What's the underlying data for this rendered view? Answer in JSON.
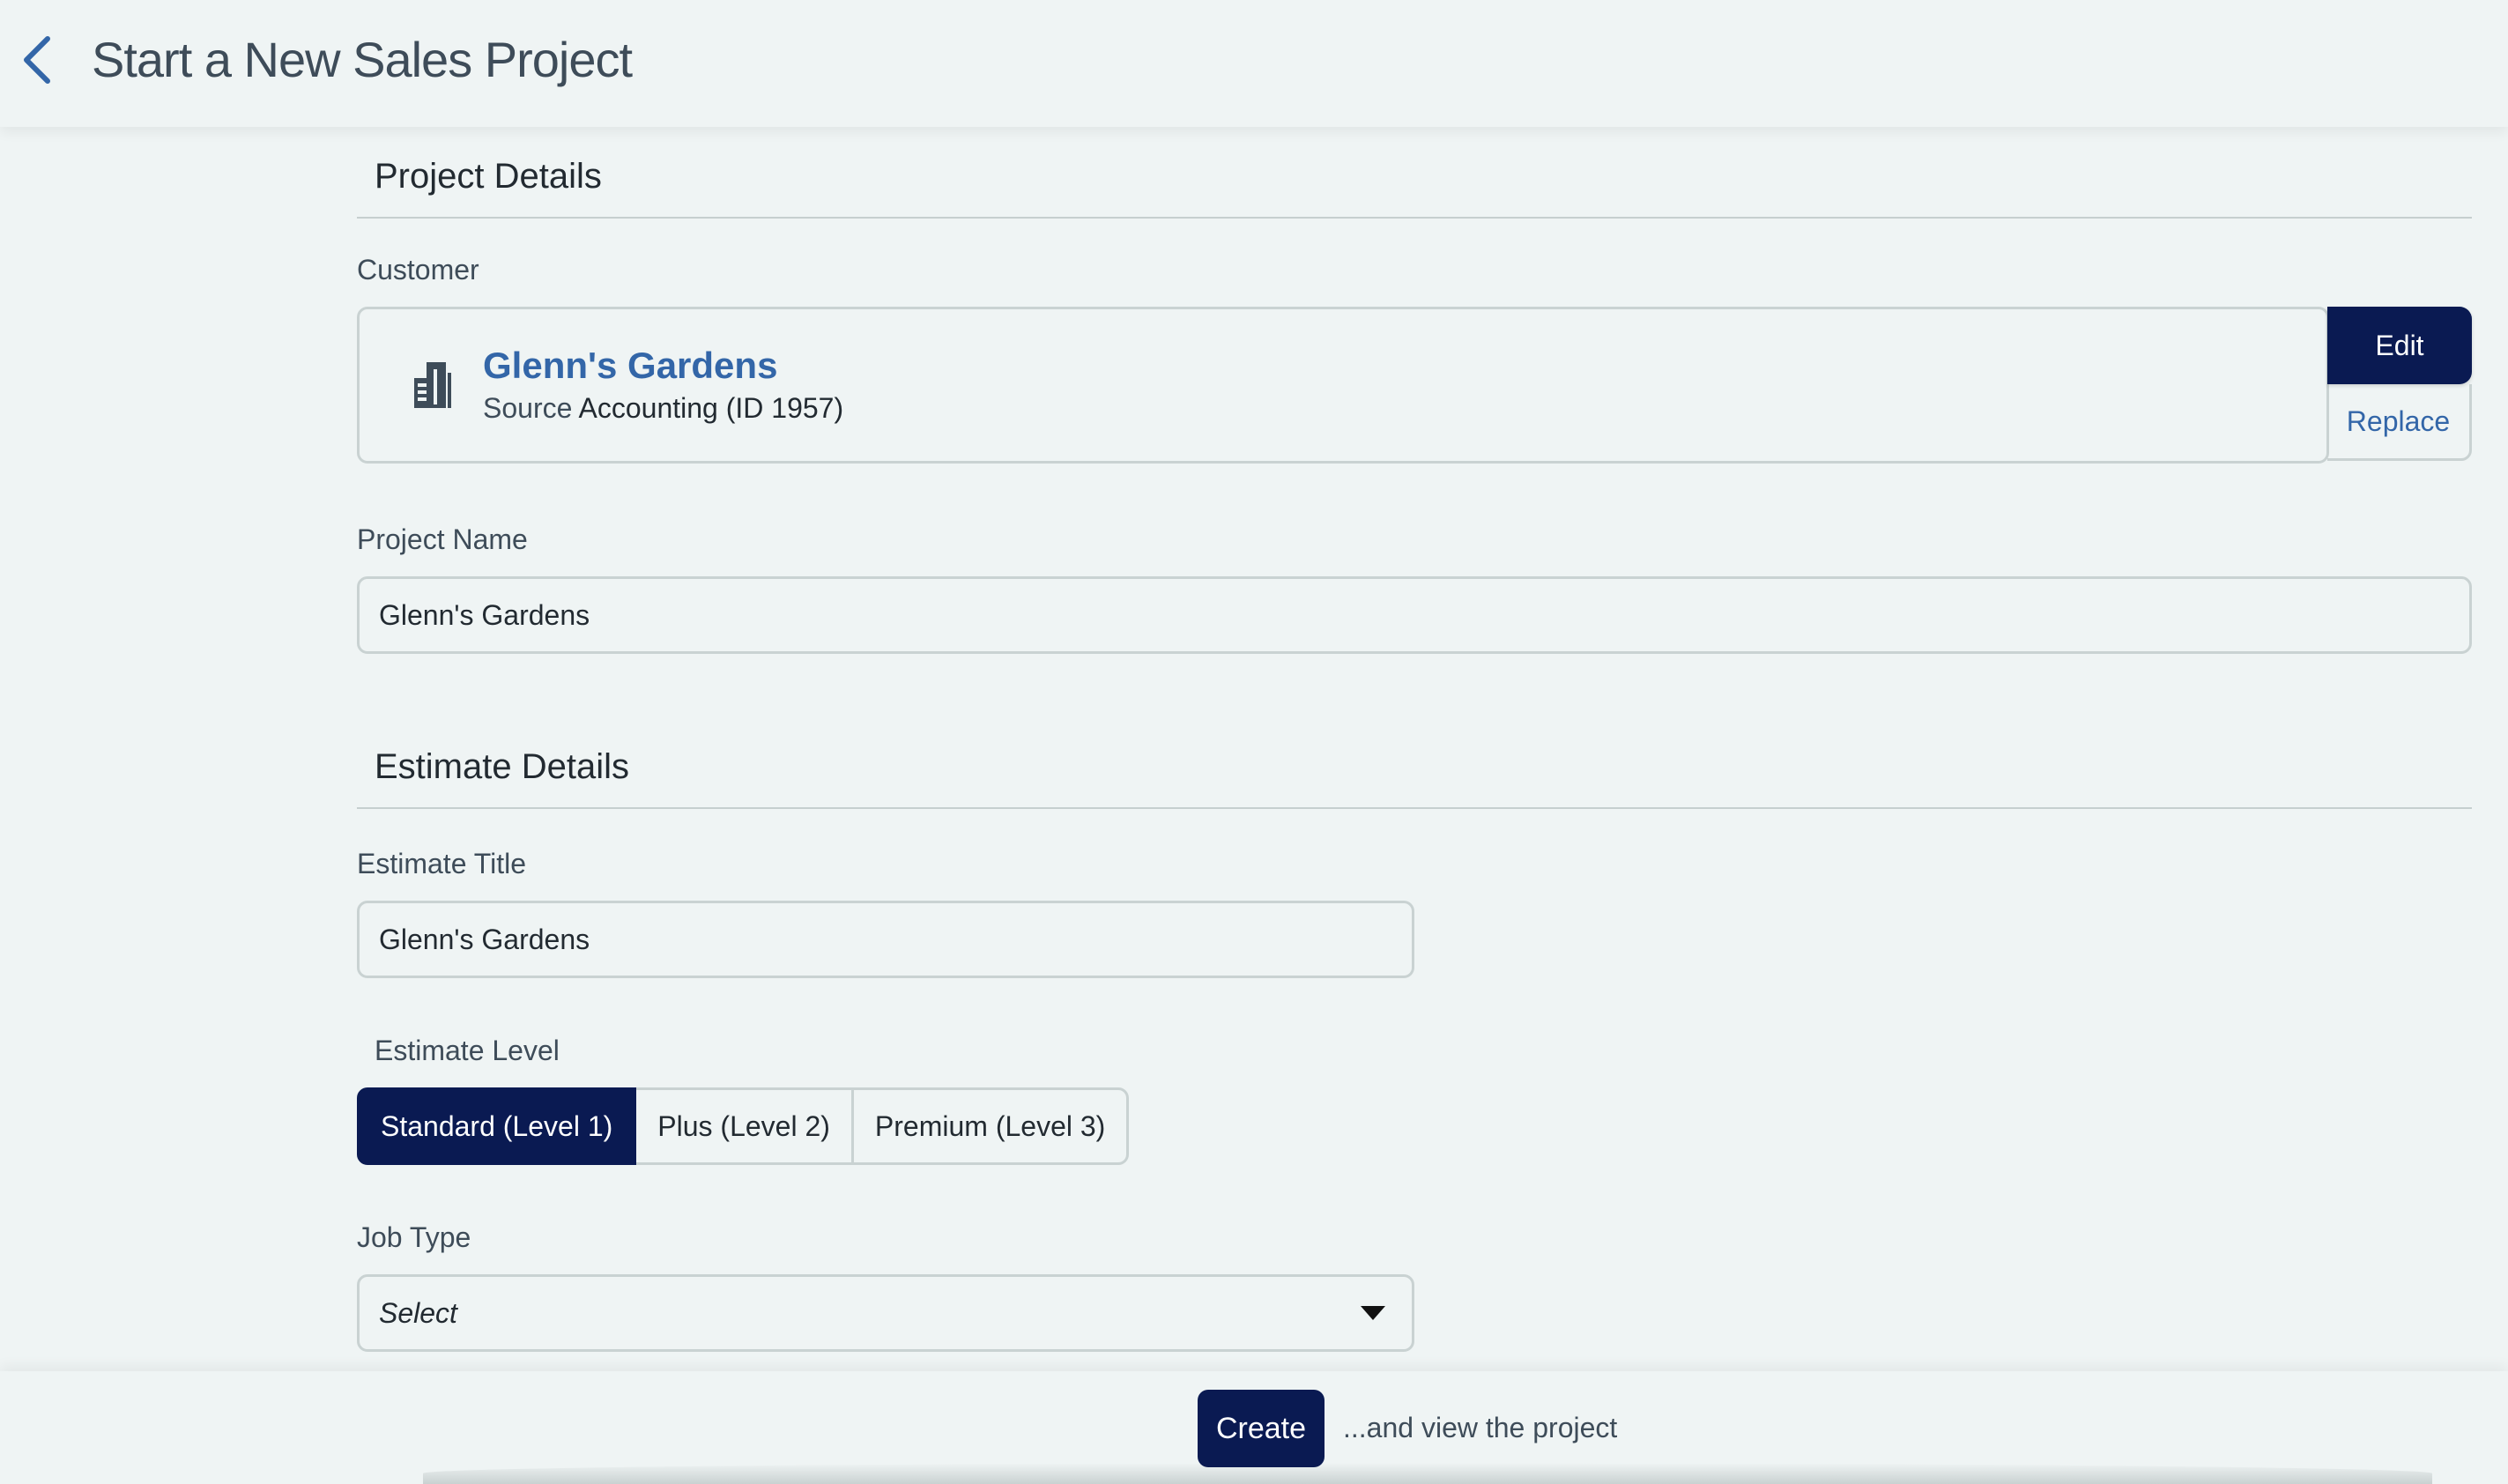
{
  "header": {
    "title": "Start a New Sales Project",
    "back_icon": "chevron-left-icon"
  },
  "project_details": {
    "section_title": "Project Details",
    "customer_label": "Customer",
    "customer": {
      "icon": "building-icon",
      "name": "Glenn's Gardens",
      "source_label": "Source",
      "source_value": "Accounting (ID 1957)",
      "edit_label": "Edit",
      "replace_label": "Replace"
    },
    "project_name_label": "Project Name",
    "project_name_value": "Glenn's Gardens"
  },
  "estimate_details": {
    "section_title": "Estimate Details",
    "estimate_title_label": "Estimate Title",
    "estimate_title_value": "Glenn's Gardens",
    "estimate_level_label": "Estimate Level",
    "levels": [
      {
        "label": "Standard (Level 1)",
        "selected": true
      },
      {
        "label": "Plus (Level 2)",
        "selected": false
      },
      {
        "label": "Premium (Level 3)",
        "selected": false
      }
    ],
    "job_type_label": "Job Type",
    "job_type_value": "Select"
  },
  "footer": {
    "create_label": "Create",
    "hint": "...and view the project"
  },
  "colors": {
    "background": "#eff4f4",
    "primary": "#0a1a52",
    "link": "#3366a8",
    "border": "#c9d2d2"
  }
}
